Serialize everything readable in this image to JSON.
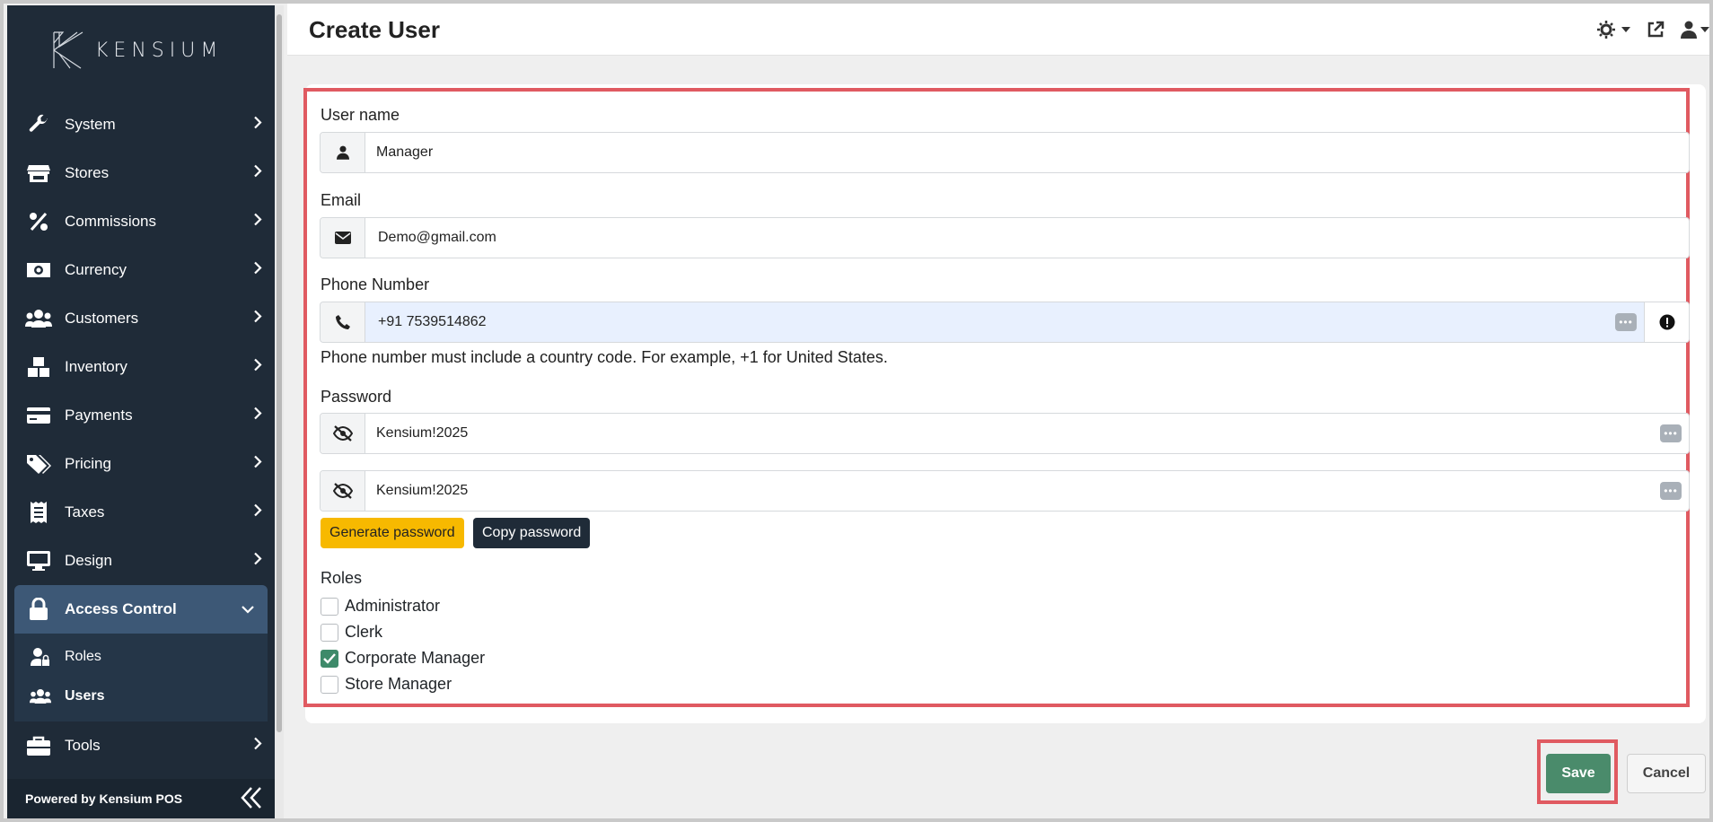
{
  "brand": {
    "logo_text": "KENSIUM",
    "footer": "Powered by Kensium POS"
  },
  "page": {
    "title": "Create User"
  },
  "sidebar": {
    "items": [
      {
        "label": "System",
        "icon": "wrench-icon"
      },
      {
        "label": "Stores",
        "icon": "store-icon"
      },
      {
        "label": "Commissions",
        "icon": "percent-icon"
      },
      {
        "label": "Currency",
        "icon": "money-icon"
      },
      {
        "label": "Customers",
        "icon": "users-icon"
      },
      {
        "label": "Inventory",
        "icon": "boxes-icon"
      },
      {
        "label": "Payments",
        "icon": "credit-card-icon"
      },
      {
        "label": "Pricing",
        "icon": "tags-icon"
      },
      {
        "label": "Taxes",
        "icon": "receipt-icon"
      },
      {
        "label": "Design",
        "icon": "monitor-icon"
      },
      {
        "label": "Access Control",
        "icon": "lock-icon",
        "expanded": true
      },
      {
        "label": "Tools",
        "icon": "toolbox-icon"
      }
    ],
    "subitems": [
      {
        "label": "Roles",
        "icon": "user-lock-icon"
      },
      {
        "label": "Users",
        "icon": "users-icon",
        "current": true
      }
    ]
  },
  "form": {
    "username": {
      "label": "User name",
      "value": "Manager"
    },
    "email": {
      "label": "Email",
      "value": "Demo@gmail.com"
    },
    "phone": {
      "label": "Phone Number",
      "value": "+91 7539514862",
      "help": "Phone number must include a country code. For example, +1 for United States."
    },
    "password": {
      "label": "Password",
      "value": "Kensium!2025",
      "confirm_value": "Kensium!2025"
    },
    "generate_label": "Generate password",
    "copy_label": "Copy password",
    "roles": {
      "label": "Roles",
      "options": [
        {
          "label": "Administrator",
          "checked": false
        },
        {
          "label": "Clerk",
          "checked": false
        },
        {
          "label": "Corporate Manager",
          "checked": true
        },
        {
          "label": "Store Manager",
          "checked": false
        }
      ]
    }
  },
  "actions": {
    "save_label": "Save",
    "cancel_label": "Cancel"
  },
  "colors": {
    "sidebar": "#1f2b38",
    "accent_save": "#4a8b6b",
    "generate": "#f7b900",
    "highlight": "#e05a61"
  }
}
